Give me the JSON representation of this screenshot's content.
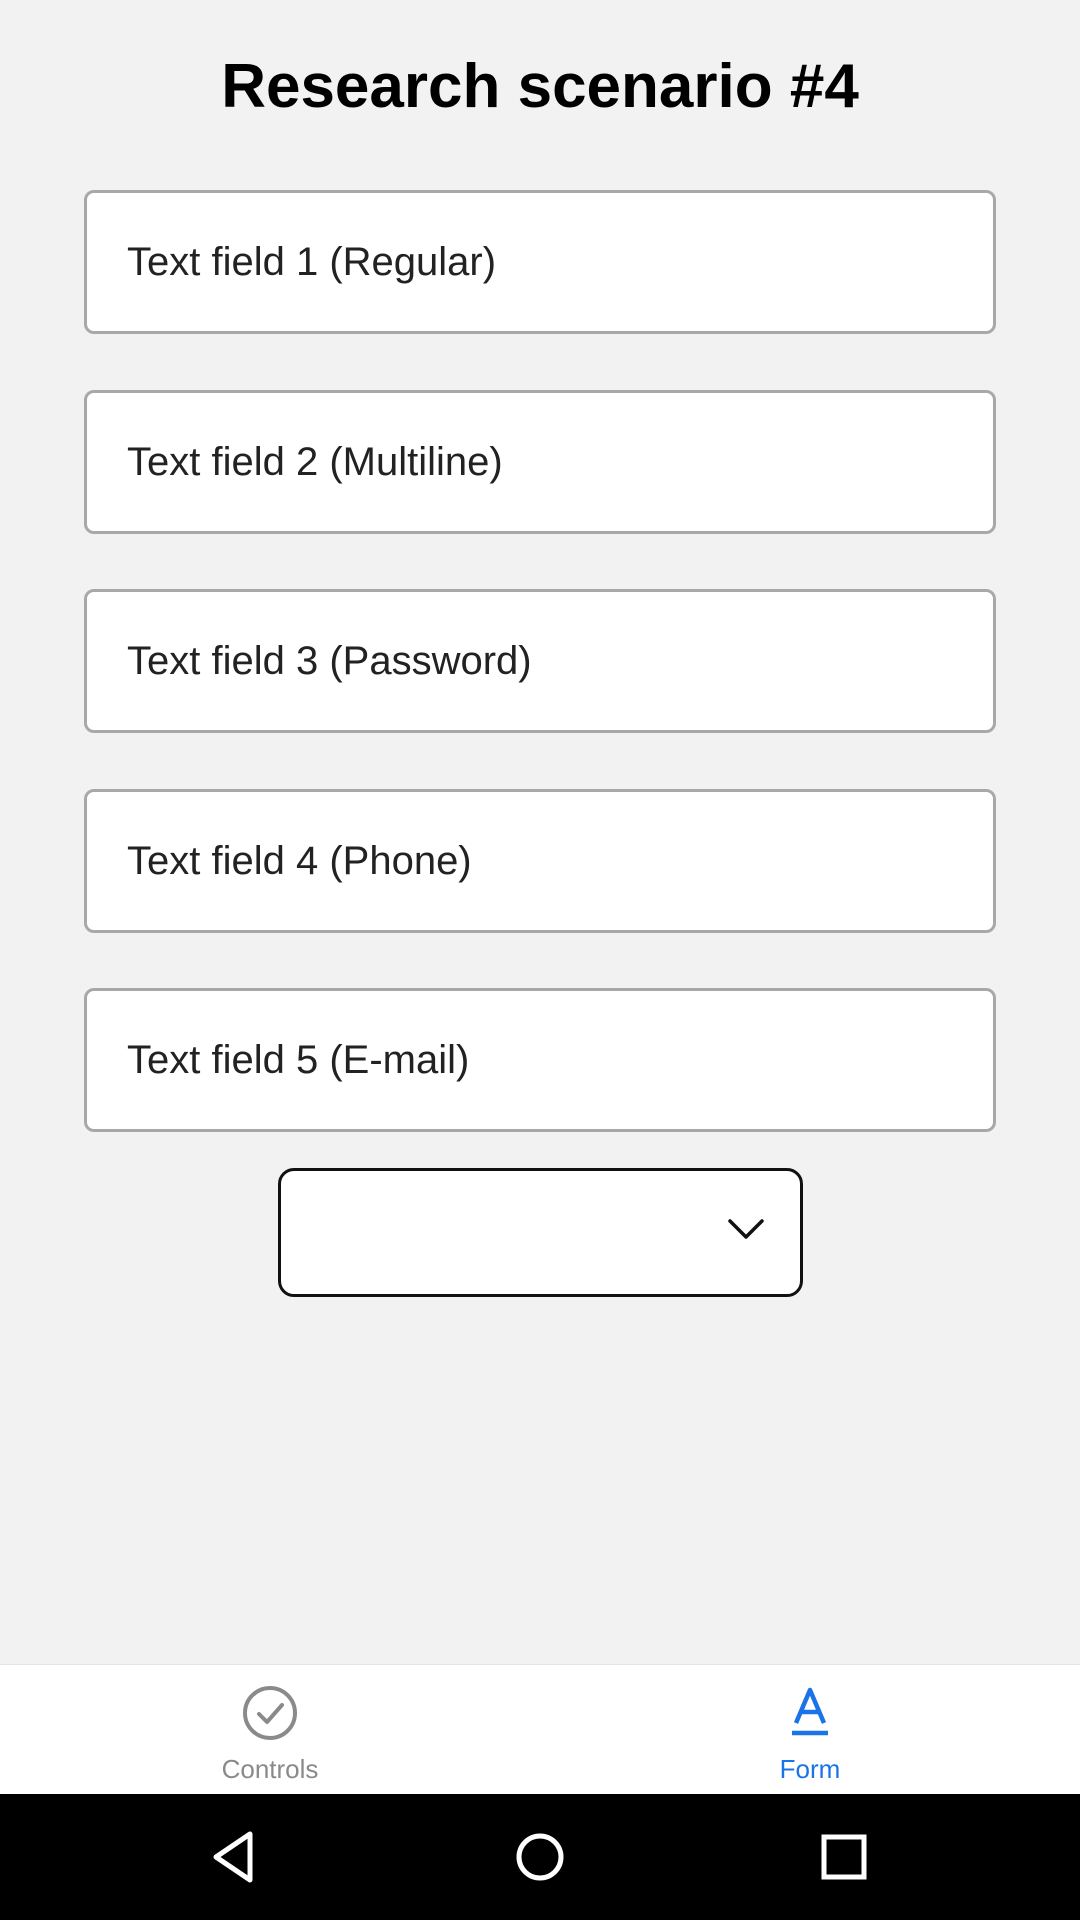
{
  "page": {
    "title": "Research scenario #4"
  },
  "form": {
    "fields": [
      {
        "placeholder": "Text field 1 (Regular)"
      },
      {
        "placeholder": "Text field 2 (Multiline)"
      },
      {
        "placeholder": "Text field 3 (Password)"
      },
      {
        "placeholder": "Text field 4 (Phone)"
      },
      {
        "placeholder": "Text field 5 (E-mail)"
      }
    ],
    "dropdown": {
      "selected": "",
      "icon": "chevron-down-icon"
    }
  },
  "tabbar": {
    "tabs": [
      {
        "label": "Controls",
        "icon": "check-circle-icon",
        "active": false
      },
      {
        "label": "Form",
        "icon": "text-format-icon",
        "active": true
      }
    ]
  },
  "navbar": {
    "buttons": [
      "back-icon",
      "home-icon",
      "recents-icon"
    ]
  },
  "colors": {
    "background": "#f2f2f2",
    "accent": "#1a73e8",
    "inactive": "#8a8a8a",
    "field_border": "#a8a8a8"
  }
}
